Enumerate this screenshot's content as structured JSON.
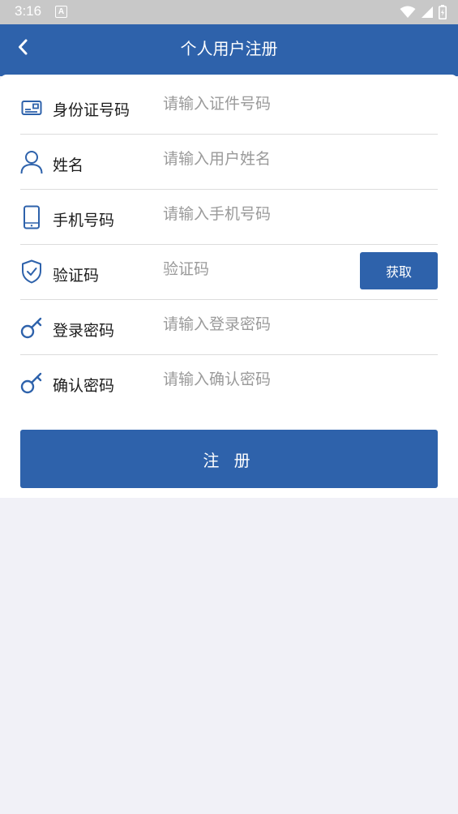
{
  "status_bar": {
    "time": "3:16",
    "notification_letter": "A",
    "icons": [
      "wifi-icon",
      "cellular-signal-icon",
      "battery-icon"
    ]
  },
  "nav": {
    "title": "个人用户注册",
    "back_icon": "chevron-left-icon"
  },
  "form": {
    "id_number": {
      "icon": "id-card-icon",
      "label": "身份证号码",
      "value": "",
      "placeholder": "请输入证件号码"
    },
    "name": {
      "icon": "user-icon",
      "label": "姓名",
      "value": "",
      "placeholder": "请输入用户姓名"
    },
    "phone": {
      "icon": "mobile-phone-icon",
      "label": "手机号码",
      "value": "",
      "placeholder": "请输入手机号码"
    },
    "code": {
      "icon": "shield-check-icon",
      "label": "验证码",
      "value": "",
      "placeholder": "验证码",
      "button_label": "获取"
    },
    "password": {
      "icon": "key-icon",
      "label": "登录密码",
      "value": "",
      "placeholder": "请输入登录密码"
    },
    "confirm_password": {
      "icon": "key-icon",
      "label": "确认密码",
      "value": "",
      "placeholder": "请输入确认密码"
    }
  },
  "register_button_label": "注 册",
  "colors": {
    "primary": "#2e62ab",
    "status_bar": "#c8c8c8",
    "background": "#f1f1f7",
    "card": "#ffffff",
    "divider": "#dcdcdc",
    "placeholder": "#9a9a9a",
    "label_text": "#1c1c1c"
  }
}
